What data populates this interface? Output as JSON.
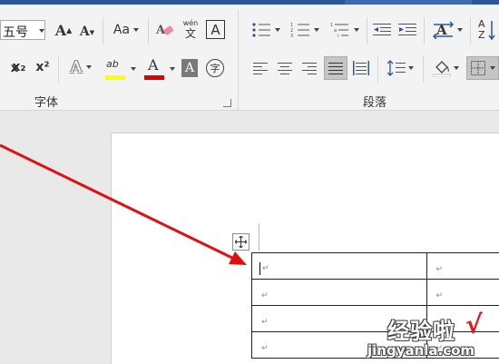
{
  "ribbon": {
    "font_size_value": "五号",
    "grow_font_glyph": "A",
    "shrink_font_glyph": "A",
    "change_case_label": "Aa",
    "phonetic_top": "wén",
    "phonetic_bottom": "文",
    "char_border_glyph": "A",
    "subscript_label": "x₂",
    "superscript_label": "x²",
    "text_effect_glyph": "A",
    "highlight_label": "ab",
    "font_color_glyph": "A",
    "char_shading_glyph": "A",
    "enclose_char_glyph": "字",
    "sort_label_top": "A",
    "sort_label_bottom": "Z",
    "font_group_label": "字体",
    "paragraph_group_label": "段落",
    "colors": {
      "highlight_yellow": "#ffff00",
      "font_red": "#e00000"
    }
  },
  "document": {
    "paragraph_mark": "↵"
  },
  "watermark": {
    "cn_text": "经验啦",
    "check": "√",
    "url": "jingyanla.com"
  }
}
